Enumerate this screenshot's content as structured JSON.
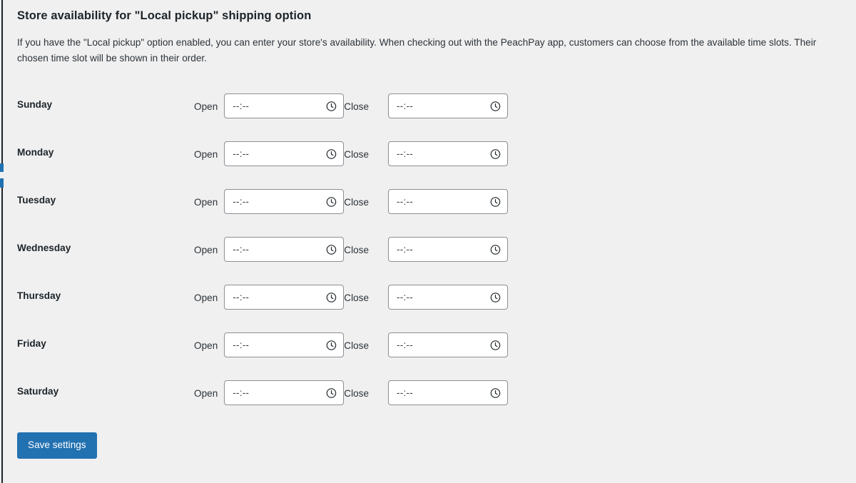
{
  "page": {
    "title": "Store availability for \"Local pickup\" shipping option",
    "description": "If you have the \"Local pickup\" option enabled, you can enter your store's availability. When checking out with the PeachPay app, customers can choose from the available time slots. Their chosen time slot will be shown in their order."
  },
  "labels": {
    "open": "Open",
    "close": "Close",
    "time_placeholder": "--:--",
    "clock_icon": "clock-icon"
  },
  "colors": {
    "background": "#f0f0f1",
    "accent": "#2271b1",
    "text": "#1d2327",
    "input_border": "#8c8f94",
    "input_background": "#ffffff"
  },
  "days": [
    {
      "name": "Sunday",
      "open_value": "--:--",
      "close_value": "--:--"
    },
    {
      "name": "Monday",
      "open_value": "--:--",
      "close_value": "--:--"
    },
    {
      "name": "Tuesday",
      "open_value": "--:--",
      "close_value": "--:--"
    },
    {
      "name": "Wednesday",
      "open_value": "--:--",
      "close_value": "--:--"
    },
    {
      "name": "Thursday",
      "open_value": "--:--",
      "close_value": "--:--"
    },
    {
      "name": "Friday",
      "open_value": "--:--",
      "close_value": "--:--"
    },
    {
      "name": "Saturday",
      "open_value": "--:--",
      "close_value": "--:--"
    }
  ],
  "footer": {
    "save_label": "Save settings"
  }
}
